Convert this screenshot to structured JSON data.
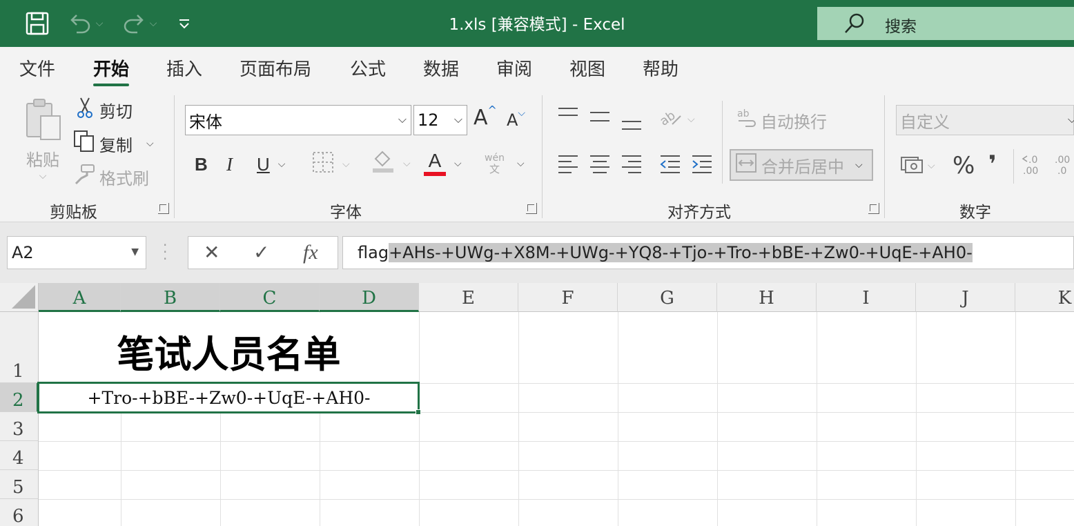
{
  "window": {
    "title": "1.xls  [兼容模式]  -  Excel",
    "search_placeholder": "搜索",
    "qat": {
      "save_icon": "save-icon",
      "undo_icon": "undo-icon",
      "redo_icon": "redo-icon",
      "customize_icon": "customize-qat-icon"
    }
  },
  "ribbon_tabs": [
    {
      "label": "文件",
      "active": false
    },
    {
      "label": "开始",
      "active": true
    },
    {
      "label": "插入",
      "active": false
    },
    {
      "label": "页面布局",
      "active": false
    },
    {
      "label": "公式",
      "active": false
    },
    {
      "label": "数据",
      "active": false
    },
    {
      "label": "审阅",
      "active": false
    },
    {
      "label": "视图",
      "active": false
    },
    {
      "label": "帮助",
      "active": false
    }
  ],
  "clipboard": {
    "group_label": "剪贴板",
    "paste": "粘贴",
    "cut": "剪切",
    "copy": "复制",
    "format_painter": "格式刷"
  },
  "font": {
    "group_label": "字体",
    "font_name": "宋体",
    "font_size": "12",
    "bold": "B",
    "italic": "I",
    "underline": "U",
    "font_color_glyph": "A",
    "phonetic_top": "wén",
    "phonetic_bottom": "文",
    "font_color": "#e81123"
  },
  "alignment": {
    "group_label": "对齐方式",
    "wrap_text": "自动换行",
    "merge_center": "合并后居中"
  },
  "number": {
    "group_label": "数字",
    "format": "自定义",
    "percent": "%",
    "comma": "❜"
  },
  "formula_bar": {
    "name_box": "A2",
    "fx": "fx",
    "formula_plain": "flag",
    "formula_selected": "+AHs-+UWg-+X8M-+UWg-+YQ8-+Tjo-+Tro-+bBE-+Zw0-+UqE-+AH0-"
  },
  "grid": {
    "columns": [
      "A",
      "B",
      "C",
      "D",
      "E",
      "F",
      "G",
      "H",
      "I",
      "J",
      "K"
    ],
    "rows": [
      "1",
      "2",
      "3",
      "4",
      "5",
      "6"
    ],
    "cell_a1": "笔试人员名单",
    "cell_a2": "+Tro-+bBE-+Zw0-+UqE-+AH0-",
    "selected_cell": "A2",
    "accent": "#217346"
  }
}
